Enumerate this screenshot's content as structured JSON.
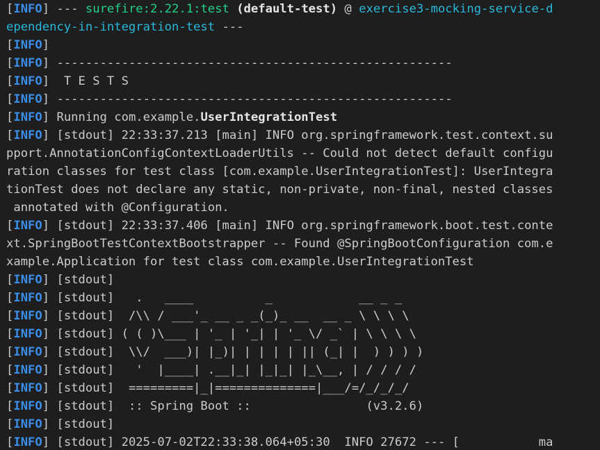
{
  "colors": {
    "background": "#1e1e1e",
    "text": "#cccccc",
    "info_tag": "#3b8eea",
    "plugin": "#23d18b",
    "project": "#29b8db",
    "bold": "#e5e5e5"
  },
  "tag": "INFO",
  "lines": [
    {
      "segments": [
        {
          "text": " --- ",
          "style": "default"
        },
        {
          "text": "surefire:2.22.1:test",
          "style": "green"
        },
        {
          "text": " ",
          "style": "default"
        },
        {
          "text": "(default-test)",
          "style": "bold"
        },
        {
          "text": " @ ",
          "style": "default"
        },
        {
          "text": "exercise3-mocking-service-d",
          "style": "cyan"
        }
      ]
    },
    {
      "tag": false,
      "segments": [
        {
          "text": "ependency-in-integration-test",
          "style": "cyan"
        },
        {
          "text": " ---",
          "style": "default"
        }
      ]
    },
    {
      "segments": []
    },
    {
      "segments": [
        {
          "text": " -------------------------------------------------------",
          "style": "default"
        }
      ]
    },
    {
      "segments": [
        {
          "text": "  T E S T S",
          "style": "default"
        }
      ]
    },
    {
      "segments": [
        {
          "text": " -------------------------------------------------------",
          "style": "default"
        }
      ]
    },
    {
      "segments": [
        {
          "text": " Running com.example.",
          "style": "default"
        },
        {
          "text": "UserIntegrationTest",
          "style": "bold"
        }
      ]
    },
    {
      "segments": [
        {
          "text": " [stdout] 22:33:37.213 [main] INFO org.springframework.test.context.su",
          "style": "default"
        }
      ]
    },
    {
      "tag": false,
      "segments": [
        {
          "text": "pport.AnnotationConfigContextLoaderUtils -- Could not detect default configu",
          "style": "default"
        }
      ]
    },
    {
      "tag": false,
      "segments": [
        {
          "text": "ration classes for test class [com.example.UserIntegrationTest]: UserIntegra",
          "style": "default"
        }
      ]
    },
    {
      "tag": false,
      "segments": [
        {
          "text": "tionTest does not declare any static, non-private, non-final, nested classes",
          "style": "default"
        }
      ]
    },
    {
      "tag": false,
      "segments": [
        {
          "text": " annotated with @Configuration.",
          "style": "default"
        }
      ]
    },
    {
      "segments": [
        {
          "text": " [stdout] 22:33:37.406 [main] INFO org.springframework.boot.test.conte",
          "style": "default"
        }
      ]
    },
    {
      "tag": false,
      "segments": [
        {
          "text": "xt.SpringBootTestContextBootstrapper -- Found @SpringBootConfiguration com.e",
          "style": "default"
        }
      ]
    },
    {
      "tag": false,
      "segments": [
        {
          "text": "xample.Application for test class com.example.UserIntegrationTest",
          "style": "default"
        }
      ]
    },
    {
      "segments": [
        {
          "text": " [stdout]",
          "style": "default"
        }
      ]
    },
    {
      "segments": [
        {
          "text": " [stdout]   .   ____          _            __ _ _",
          "style": "default"
        }
      ]
    },
    {
      "segments": [
        {
          "text": " [stdout]  /\\\\ / ___'_ __ _ _(_)_ __  __ _ \\ \\ \\ \\",
          "style": "default"
        }
      ]
    },
    {
      "segments": [
        {
          "text": " [stdout] ( ( )\\___ | '_ | '_| | '_ \\/ _` | \\ \\ \\ \\",
          "style": "default"
        }
      ]
    },
    {
      "segments": [
        {
          "text": " [stdout]  \\\\/  ___)| |_)| | | | | || (_| |  ) ) ) )",
          "style": "default"
        }
      ]
    },
    {
      "segments": [
        {
          "text": " [stdout]   '  |____| .__|_| |_|_| |_\\__, | / / / /",
          "style": "default"
        }
      ]
    },
    {
      "segments": [
        {
          "text": " [stdout]  =========|_|==============|___/=/_/_/_/",
          "style": "default"
        }
      ]
    },
    {
      "segments": [
        {
          "text": " [stdout]  :: Spring Boot ::                (v3.2.6)",
          "style": "default"
        }
      ]
    },
    {
      "segments": [
        {
          "text": " [stdout]",
          "style": "default"
        }
      ]
    },
    {
      "segments": [
        {
          "text": " [stdout] 2025-07-02T22:33:38.064+05:30  INFO 27672 --- [           ma",
          "style": "default"
        }
      ]
    }
  ]
}
